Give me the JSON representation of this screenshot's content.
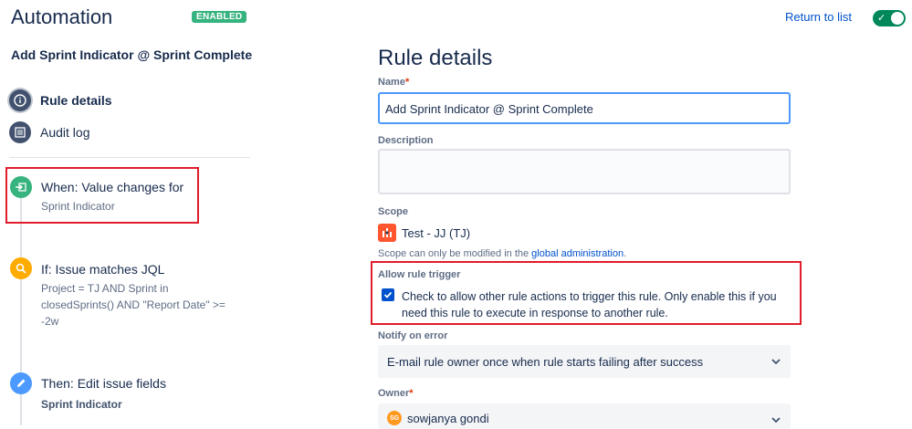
{
  "header": {
    "title": "Automation",
    "status_badge": "ENABLED",
    "return_link": "Return to list"
  },
  "sidebar": {
    "rule_name": "Add Sprint Indicator @ Sprint Complete",
    "nav": [
      {
        "label": "Rule details",
        "icon": "info-icon"
      },
      {
        "label": "Audit log",
        "icon": "list-icon"
      }
    ],
    "steps": [
      {
        "title": "When: Value changes for",
        "subtitle": "Sprint Indicator",
        "icon": "trigger-icon",
        "color": "#36b37e"
      },
      {
        "title": "If: Issue matches JQL",
        "subtitle_lines": [
          "Project = TJ AND Sprint in",
          "closedSprints() AND \"Report Date\" >=",
          "-2w"
        ],
        "icon": "search-icon",
        "color": "#ffab00"
      },
      {
        "title": "Then: Edit issue fields",
        "subtitle": "Sprint Indicator",
        "icon": "pencil-icon",
        "color": "#4c9aff"
      }
    ]
  },
  "main": {
    "heading": "Rule details",
    "name_label": "Name",
    "name_value": "Add Sprint Indicator @ Sprint Complete",
    "description_label": "Description",
    "description_value": "",
    "scope_label": "Scope",
    "scope_value": "Test - JJ (TJ)",
    "scope_help_prefix": "Scope can only be modified in the ",
    "scope_help_link": "global administration",
    "scope_help_suffix": ".",
    "allow_trigger_label": "Allow rule trigger",
    "allow_trigger_text_1": "Check to allow other rule actions to trigger this rule. Only enable this if you",
    "allow_trigger_text_2": "need this rule to execute in response to another rule.",
    "notify_label": "Notify on error",
    "notify_value": "E-mail rule owner once when rule starts failing after success",
    "owner_label": "Owner",
    "owner_initials": "SG",
    "owner_value": "sowjanya gondi",
    "required_mark": "*"
  },
  "colors": {
    "accent": "#0052cc",
    "enabled": "#36b37e",
    "toggle_on": "#00875a",
    "highlight": "#e11d2b"
  }
}
